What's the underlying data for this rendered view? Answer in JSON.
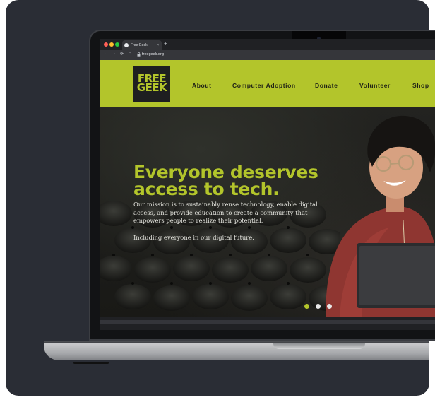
{
  "browser": {
    "tab_title": "Free Geek",
    "tab_close": "×",
    "new_tab": "+",
    "url": "freegeek.org",
    "nav_back": "←",
    "nav_forward": "→",
    "nav_reload": "⟳",
    "nav_home": "⌂"
  },
  "site": {
    "logo_line1": "FREE",
    "logo_line2": "GEEK",
    "nav": [
      "About",
      "Computer Adoption",
      "Donate",
      "Volunteer",
      "Shop"
    ]
  },
  "hero": {
    "title": "Everyone deserves access to tech.",
    "mission": "Our mission is to sustainably reuse technology, enable digital access, and provide education to create a community that empowers people to realize their potential.",
    "tagline": "Including everyone in our digital future.",
    "slides_total": 3,
    "active_slide": 1
  },
  "colors": {
    "accent": "#b3c52b",
    "card_bg": "#2a2d35",
    "logo_bg": "#1e1f20"
  }
}
